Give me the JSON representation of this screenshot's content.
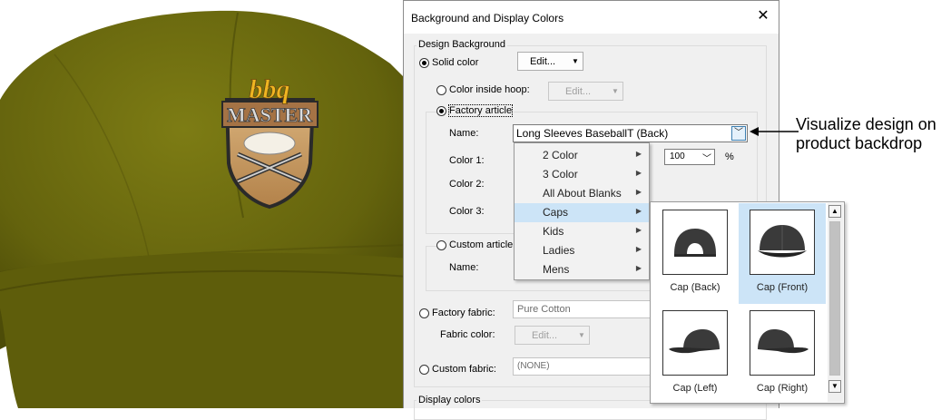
{
  "dialog": {
    "title": "Background and Display Colors",
    "close_glyph": "✕",
    "design_background": {
      "group_label": "Design Background",
      "solid_color": {
        "label": "Solid color",
        "selected": true,
        "button": "Edit..."
      },
      "color_inside_hoop": {
        "label": "Color inside hoop:",
        "selected": false,
        "button": "Edit...",
        "enabled": false
      },
      "factory_article": {
        "label": "Factory article",
        "selected": true,
        "name_label": "Name:",
        "name_value": "Long Sleeves BaseballT (Back)",
        "color1_label": "Color 1:",
        "color1_value": "100",
        "color1_unit": "%",
        "color2_label": "Color 2:",
        "color3_label": "Color 3:"
      },
      "custom_article": {
        "label": "Custom article",
        "selected": false,
        "name_label": "Name:"
      },
      "factory_fabric": {
        "label": "Factory fabric:",
        "selected": false,
        "value": "Pure Cotton",
        "fabric_color_label": "Fabric color:",
        "button": "Edit..."
      },
      "custom_fabric": {
        "label": "Custom fabric:",
        "selected": false,
        "value": "(NONE)"
      }
    },
    "display_colors_label": "Display colors"
  },
  "category_menu": {
    "items": [
      {
        "label": "2 Color",
        "highlighted": false
      },
      {
        "label": "3 Color",
        "highlighted": false
      },
      {
        "label": "All About Blanks",
        "highlighted": false
      },
      {
        "label": "Caps",
        "highlighted": true
      },
      {
        "label": "Kids",
        "highlighted": false
      },
      {
        "label": "Ladies",
        "highlighted": false
      },
      {
        "label": "Mens",
        "highlighted": false
      }
    ]
  },
  "article_thumbnails": [
    {
      "label": "Cap (Back)",
      "selected": false,
      "icon": "cap-back-icon"
    },
    {
      "label": "Cap (Front)",
      "selected": true,
      "icon": "cap-front-icon"
    },
    {
      "label": "Cap (Left)",
      "selected": false,
      "icon": "cap-left-icon"
    },
    {
      "label": "Cap (Right)",
      "selected": false,
      "icon": "cap-right-icon"
    }
  ],
  "annotation": {
    "text": "Visualize design on product backdrop"
  },
  "product_image": {
    "logo_line1": "bbq",
    "logo_line2": "MASTER",
    "cap_color": "#6b6a0e"
  },
  "colors": {
    "menu_highlight": "#cce4f7",
    "dialog_bg": "#f0f0f0"
  }
}
